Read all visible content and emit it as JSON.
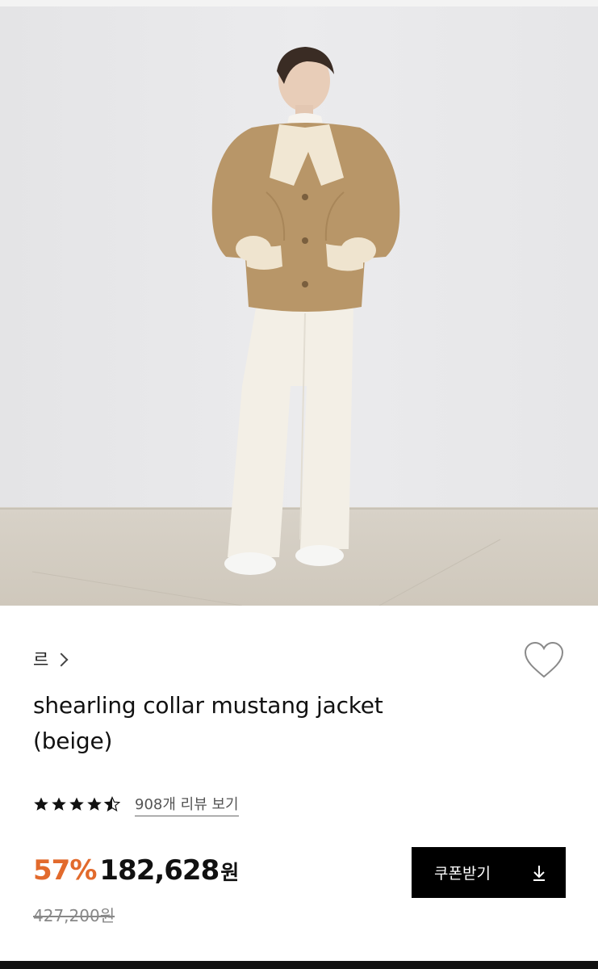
{
  "product": {
    "image_alt": "model wearing beige shearling collar jacket",
    "brand": "르",
    "title_line1": "shearling collar mustang jacket",
    "title_line2": "(beige)",
    "rating": 4.5,
    "review_text": "908개 리뷰 보기",
    "discount": "57%",
    "price": "182,628",
    "price_unit": "원",
    "original_price": "427,200원"
  },
  "coupon": {
    "label": "쿠폰받기"
  },
  "icons": {
    "wishlist": "heart-outline-icon",
    "download": "download-icon",
    "chevron": "chevron-right-icon"
  },
  "colors": {
    "accent": "#e26a2c",
    "button_bg": "#000000",
    "jacket": "#b89668"
  }
}
